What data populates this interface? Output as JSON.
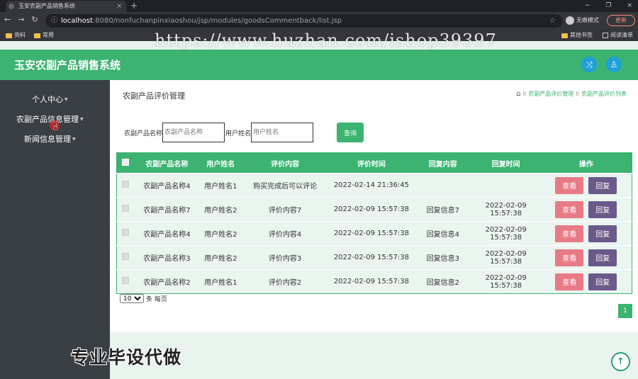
{
  "browser": {
    "tab_title": "玉安农副产品销售系统",
    "tab_close": "×",
    "new_tab": "+",
    "window_controls": [
      "−",
      "❐",
      "×"
    ],
    "url_host": "localhost",
    "url_path": ":8080/nonfuchanpinxiaoshou/jsp/modules/goodsCommentback/list.jsp",
    "incognito_label": "无痕模式",
    "update_label": "更新",
    "bookmarks": [
      "资料",
      "常用"
    ],
    "bookmarks_right": [
      "其他书签",
      "阅读清单"
    ]
  },
  "watermark": "https://www.huzhan.com/ishop39397",
  "app": {
    "title": "玉安农副产品销售系统",
    "header_icons": [
      "shuffle-icon",
      "user-icon"
    ]
  },
  "sidebar": {
    "items": [
      {
        "label": "个人中心",
        "caret": "▼"
      },
      {
        "label": "农副产品信息管理",
        "caret": "▼"
      },
      {
        "label": "新闻信息管理",
        "caret": "▼"
      }
    ]
  },
  "page": {
    "title": "农副产品评价管理",
    "breadcrumb": [
      "农副产品评价管理",
      "农副产品评价列表"
    ],
    "breadcrumb_sep": "II"
  },
  "search": {
    "product_label": "农副产品名称",
    "product_placeholder": "农副产品名称",
    "user_label": "用户姓名",
    "user_placeholder": "用户姓名",
    "button": "查询"
  },
  "table": {
    "headers": [
      "农副产品名称",
      "用户姓名",
      "评价内容",
      "评价时间",
      "回复内容",
      "回复时间",
      "操作"
    ],
    "view_label": "查看",
    "reply_label": "回复",
    "rows": [
      {
        "product": "农副产品名称4",
        "user": "用户姓名1",
        "content": "购买完成后可以评论",
        "time": "2022-02-14 21:36:45",
        "reply": "",
        "reply_time": ""
      },
      {
        "product": "农副产品名称7",
        "user": "用户姓名2",
        "content": "评价内容7",
        "time": "2022-02-09 15:57:38",
        "reply": "回复信息7",
        "reply_time": "2022-02-09 15:57:38"
      },
      {
        "product": "农副产品名称4",
        "user": "用户姓名2",
        "content": "评价内容4",
        "time": "2022-02-09 15:57:38",
        "reply": "回复信息4",
        "reply_time": "2022-02-09 15:57:38"
      },
      {
        "product": "农副产品名称3",
        "user": "用户姓名2",
        "content": "评价内容3",
        "time": "2022-02-09 15:57:38",
        "reply": "回复信息3",
        "reply_time": "2022-02-09 15:57:38"
      },
      {
        "product": "农副产品名称2",
        "user": "用户姓名1",
        "content": "评价内容2",
        "time": "2022-02-09 15:57:38",
        "reply": "回复信息2",
        "reply_time": "2022-02-09 15:57:38"
      }
    ]
  },
  "pager": {
    "page_size": "10",
    "page_size_suffix": "条 每页",
    "current_page": "1"
  },
  "promo": "专业毕设代做",
  "colors": {
    "accent": "#3cb371",
    "sidebar": "#3a3f44",
    "view_button": "#e87a86",
    "reply_button": "#6a5a8c",
    "header_icon": "#1ea0d8"
  }
}
